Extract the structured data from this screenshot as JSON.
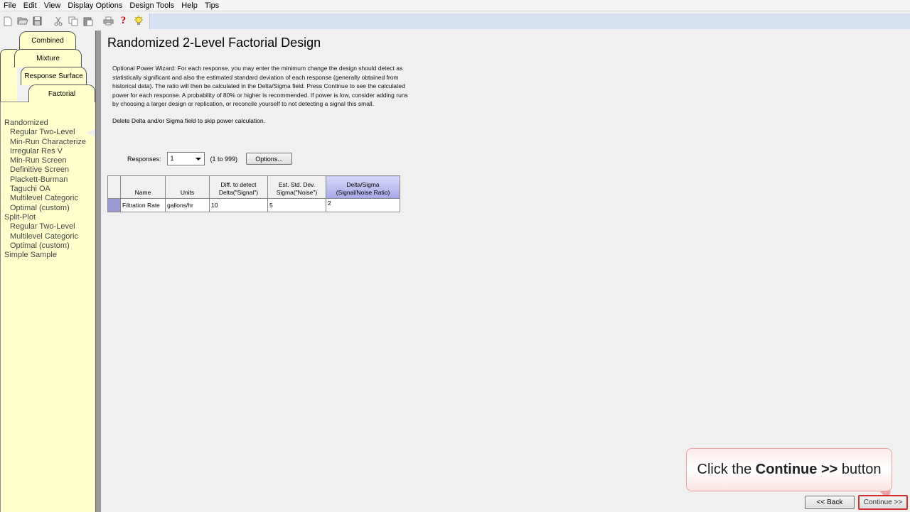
{
  "menu": [
    "File",
    "Edit",
    "View",
    "Display Options",
    "Design Tools",
    "Help",
    "Tips"
  ],
  "toolbar": {
    "icons": [
      "new-file-icon",
      "open-folder-icon",
      "save-icon",
      "cut-icon",
      "copy-icon",
      "paste-icon",
      "print-icon",
      "help-icon",
      "tip-bulb-icon"
    ],
    "help_glyph": "?",
    "accent": "#c00000"
  },
  "tabs": {
    "combined": "Combined",
    "mixture": "Mixture",
    "response_surface": "Response Surface",
    "factorial": "Factorial"
  },
  "design_list": [
    {
      "label": "Randomized",
      "level": 0
    },
    {
      "label": "Regular Two-Level",
      "level": 1
    },
    {
      "label": "Min-Run Characterize",
      "level": 1
    },
    {
      "label": "Irregular Res V",
      "level": 1
    },
    {
      "label": "Min-Run Screen",
      "level": 1
    },
    {
      "label": "Definitive Screen",
      "level": 1
    },
    {
      "label": "Plackett-Burman",
      "level": 1
    },
    {
      "label": "Taguchi OA",
      "level": 1
    },
    {
      "label": "Multilevel Categoric",
      "level": 1
    },
    {
      "label": "Optimal (custom)",
      "level": 1
    },
    {
      "label": "Split-Plot",
      "level": 0
    },
    {
      "label": "Regular Two-Level",
      "level": 1
    },
    {
      "label": "Multilevel Categoric",
      "level": 1
    },
    {
      "label": "Optimal (custom)",
      "level": 1
    },
    {
      "label": "Simple Sample",
      "level": 0
    }
  ],
  "main": {
    "title": "Randomized 2-Level Factorial Design",
    "intro": "Optional Power Wizard: For each response, you may enter the minimum change the design should detect as\nstatistically significant and also the estimated standard deviation of each response (generally obtained from\nhistorical data). The ratio will then be calculated in the Delta/Sigma field. Press Continue to see the calculated\npower for each response. A probability of 80% or higher is recommended. If power is low, consider adding runs\nby choosing a larger design or replication, or reconcile yourself to not detecting a signal this small.",
    "skip_note": "Delete Delta and/or Sigma field to skip power calculation.",
    "responses_label": "Responses:",
    "responses_value": "1",
    "responses_range": "(1 to 999)",
    "options_label": "Options..."
  },
  "grid": {
    "headers": {
      "name": "Name",
      "units": "Units",
      "diff_line1": "Diff. to detect",
      "diff_line2": "Delta(\"Signal\")",
      "std_line1": "Est. Std. Dev.",
      "std_line2": "Sigma(\"Noise\")",
      "ratio_line1": "Delta/Sigma",
      "ratio_line2": "(Signal/Noise Ratio)"
    },
    "rows": [
      {
        "name": "Filtration Rate",
        "units": "gallons/hr",
        "delta": "10",
        "sigma": "5",
        "ratio": "2"
      }
    ]
  },
  "callout": {
    "prefix": "Click the ",
    "bold": "Continue >>",
    "suffix": " button",
    "border_color": "#e8a0a0"
  },
  "buttons": {
    "back": "<< Back",
    "continue": "Continue >>"
  }
}
